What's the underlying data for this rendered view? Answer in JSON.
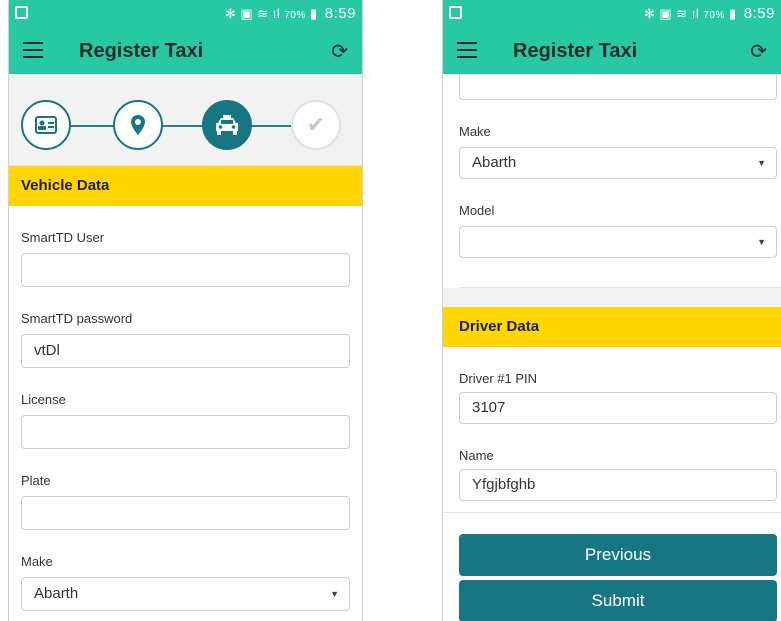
{
  "status_bar": {
    "signal_icons": "✻ ▣ ≋ ıl",
    "battery": "70%",
    "time": "8:59"
  },
  "app_bar": {
    "title": "Register Taxi"
  },
  "stepper": {
    "steps": [
      "id-card",
      "location",
      "taxi",
      "check"
    ]
  },
  "left": {
    "vehicle_header": "Vehicle Data",
    "fields": {
      "smarttd_user_label": "SmartTD User",
      "smarttd_user_value": "",
      "smarttd_password_label": "SmartTD password",
      "smarttd_password_value": "vtDl",
      "license_label": "License",
      "license_value": "",
      "plate_label": "Plate",
      "plate_value": "",
      "make_label": "Make",
      "make_value": "Abarth"
    }
  },
  "right": {
    "make_label": "Make",
    "make_value": "Abarth",
    "model_label": "Model",
    "model_value": "",
    "driver_header": "Driver Data",
    "driver_pin_label": "Driver #1 PIN",
    "driver_pin_value": "3107",
    "name_label": "Name",
    "name_value": "Yfgjbfghb",
    "previous_label": "Previous",
    "submit_label": "Submit"
  },
  "colors": {
    "accent": "#27c9a3",
    "header_yellow": "#ffd600",
    "teal_button": "#167684"
  }
}
